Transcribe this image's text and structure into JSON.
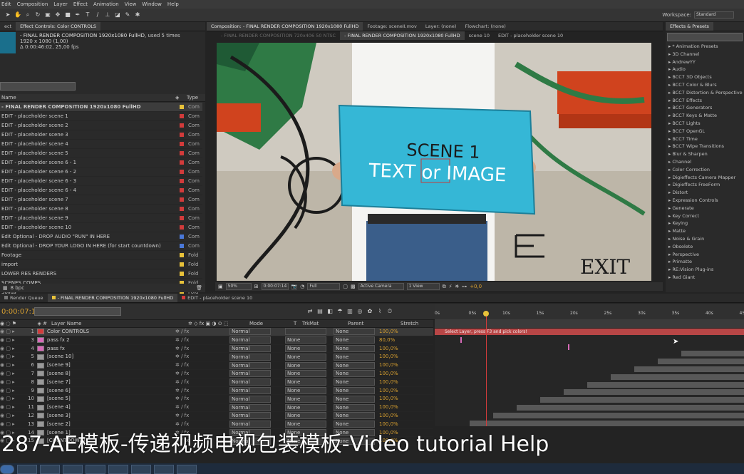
{
  "menu": {
    "items": [
      "Edit",
      "Composition",
      "Layer",
      "Effect",
      "Animation",
      "View",
      "Window",
      "Help"
    ]
  },
  "workspace": {
    "label": "Workspace:",
    "value": "Standard"
  },
  "panel_tabs": {
    "effect_controls": "Effect Controls: Color CONTROLS",
    "composition": "Composition: - FINAL RENDER COMPOSITION 1920x1080 FullHD",
    "footage": "Footage: sceneII.mov",
    "layer": "Layer: (none)",
    "flowchart": "Flowchart: (none)",
    "effects_presets": "Effects & Presets"
  },
  "project": {
    "comp_name": "- FINAL RENDER COMPOSITION 1920x1080 FullHD",
    "used_times": ", used 5 times",
    "dims": "1920 x 1080 (1,00)",
    "duration": "Δ 0:00:46:02, 25,00 fps",
    "col_name": "Name",
    "col_type": "Type",
    "bpc": "8 bpc",
    "items": [
      {
        "name": "- FINAL RENDER COMPOSITION 1920x1080 FullHD",
        "color": "#e8c23a",
        "type": "Com",
        "bold": true
      },
      {
        "name": "EDIT - placeholder  scene 1",
        "color": "#d23b3b",
        "type": "Com"
      },
      {
        "name": "EDIT - placeholder  scene 2",
        "color": "#d23b3b",
        "type": "Com"
      },
      {
        "name": "EDIT - placeholder  scene 3",
        "color": "#d23b3b",
        "type": "Com"
      },
      {
        "name": "EDIT - placeholder  scene 4",
        "color": "#d23b3b",
        "type": "Com"
      },
      {
        "name": "EDIT - placeholder  scene 5",
        "color": "#d23b3b",
        "type": "Com"
      },
      {
        "name": "EDIT - placeholder  scene 6 - 1",
        "color": "#d23b3b",
        "type": "Com"
      },
      {
        "name": "EDIT - placeholder  scene 6 - 2",
        "color": "#d23b3b",
        "type": "Com"
      },
      {
        "name": "EDIT - placeholder  scene 6 - 3",
        "color": "#d23b3b",
        "type": "Com"
      },
      {
        "name": "EDIT - placeholder  scene 6 - 4",
        "color": "#d23b3b",
        "type": "Com"
      },
      {
        "name": "EDIT - placeholder scene 7",
        "color": "#d23b3b",
        "type": "Com"
      },
      {
        "name": "EDIT - placeholder scene 8",
        "color": "#d23b3b",
        "type": "Com"
      },
      {
        "name": "EDIT - placeholder scene 9",
        "color": "#d23b3b",
        "type": "Com"
      },
      {
        "name": "EDIT - placeholder scene 10",
        "color": "#d23b3b",
        "type": "Com"
      },
      {
        "name": "Edit Optional - DROP AUDIO \"RUN\" IN HERE",
        "color": "#4a78d8",
        "type": "Com"
      },
      {
        "name": "Edit Optional - DROP YOUR LOGO IN HERE (for start countdown)",
        "color": "#4a78d8",
        "type": "Com"
      },
      {
        "name": "Footage",
        "color": "#e8c23a",
        "type": "Fold"
      },
      {
        "name": "import",
        "color": "#e8c23a",
        "type": "Fold"
      },
      {
        "name": "LOWER RES RENDERS",
        "color": "#e8c23a",
        "type": "Fold"
      },
      {
        "name": "SCENES COMPS",
        "color": "#e8c23a",
        "type": "Fold"
      },
      {
        "name": "Solids",
        "color": "#e8c23a",
        "type": "Fold"
      }
    ]
  },
  "comp_tabs": [
    "- FINAL RENDER COMPOSITION 720x406 50 NTSC",
    "- FINAL RENDER COMPOSITION 1920x1080 FullHD",
    "scene 10",
    "EDIT - placeholder scene 10"
  ],
  "viewer": {
    "sign_line1": "SCENE 1",
    "sign_line2": "TEXT or IMAGE",
    "graffiti": "EXIT",
    "zoom": "50%",
    "timecode": "0:00:07:14",
    "resolution": "Full",
    "camera": "Active Camera",
    "views": "1 View",
    "exposure": "+0,0"
  },
  "effects": [
    "* Animation Presets",
    "3D Channel",
    "AndrewYY",
    "Audio",
    "BCC7 3D Objects",
    "BCC7 Color & Blurs",
    "BCC7 Distortion & Perspective",
    "BCC7 Effects",
    "BCC7 Generators",
    "BCC7 Keys & Matte",
    "BCC7 Lights",
    "BCC7 OpenGL",
    "BCC7 Time",
    "BCC7 Wipe Transitions",
    "Blur & Sharpen",
    "Channel",
    "Color Correction",
    "Digieffects Camera Mapper",
    "Digieffects FreeForm",
    "Distort",
    "Expression Controls",
    "Generate",
    "Key Correct",
    "Keying",
    "Matte",
    "Noise & Grain",
    "Obsolete",
    "Perspective",
    "Primatte",
    "RE:Vision Plug-ins",
    "Red Giant"
  ],
  "timeline": {
    "tabs": [
      "Render Queue",
      "- FINAL RENDER COMPOSITION 1920x1080 FullHD",
      "EDIT - placeholder scene 10"
    ],
    "timecode": "0:00:07:14",
    "cols": {
      "layer_name": "Layer Name",
      "mode": "Mode",
      "t": "T",
      "trkmat": "TrkMat",
      "parent": "Parent",
      "stretch": "Stretch"
    },
    "ruler": [
      "0s",
      "05s",
      "10s",
      "15s",
      "20s",
      "25s",
      "30s",
      "35s",
      "40s",
      "45s"
    ],
    "tooltip": "Select Layer, press F3 and pick colors!",
    "layers": [
      {
        "num": "1",
        "name": "Color CONTROLS",
        "color": "#d23b3b",
        "mode": "Normal",
        "trkmat": "",
        "parent": "None",
        "stretch": "100,0%"
      },
      {
        "num": "3",
        "name": "pass fx 2",
        "color": "#d86ab8",
        "mode": "Normal",
        "trkmat": "None",
        "parent": "None",
        "stretch": "80,0%"
      },
      {
        "num": "4",
        "name": "pass fx",
        "color": "#d86ab8",
        "mode": "Normal",
        "trkmat": "None",
        "parent": "None",
        "stretch": "100,0%"
      },
      {
        "num": "5",
        "name": "[scene 10]",
        "color": "#9a9a9a",
        "mode": "Normal",
        "trkmat": "None",
        "parent": "None",
        "stretch": "100,0%"
      },
      {
        "num": "6",
        "name": "[scene 9]",
        "color": "#9a9a9a",
        "mode": "Normal",
        "trkmat": "None",
        "parent": "None",
        "stretch": "100,0%"
      },
      {
        "num": "7",
        "name": "[scene 8]",
        "color": "#9a9a9a",
        "mode": "Normal",
        "trkmat": "None",
        "parent": "None",
        "stretch": "100,0%"
      },
      {
        "num": "8",
        "name": "[scene 7]",
        "color": "#9a9a9a",
        "mode": "Normal",
        "trkmat": "None",
        "parent": "None",
        "stretch": "100,0%"
      },
      {
        "num": "9",
        "name": "[scene 6]",
        "color": "#9a9a9a",
        "mode": "Normal",
        "trkmat": "None",
        "parent": "None",
        "stretch": "100,0%"
      },
      {
        "num": "10",
        "name": "[scene 5]",
        "color": "#9a9a9a",
        "mode": "Normal",
        "trkmat": "None",
        "parent": "None",
        "stretch": "100,0%"
      },
      {
        "num": "11",
        "name": "[scene 4]",
        "color": "#9a9a9a",
        "mode": "Normal",
        "trkmat": "None",
        "parent": "None",
        "stretch": "100,0%"
      },
      {
        "num": "12",
        "name": "[scene 3]",
        "color": "#9a9a9a",
        "mode": "Normal",
        "trkmat": "None",
        "parent": "None",
        "stretch": "100,0%"
      },
      {
        "num": "13",
        "name": "[scene 2]",
        "color": "#9a9a9a",
        "mode": "Normal",
        "trkmat": "None",
        "parent": "None",
        "stretch": "100,0%"
      },
      {
        "num": "14",
        "name": "[scene 1]",
        "color": "#9a9a9a",
        "mode": "Normal",
        "trkmat": "None",
        "parent": "None",
        "stretch": "100,0%"
      },
      {
        "num": "15",
        "name": "[COUNTDOWN]",
        "color": "#9a9a9a",
        "mode": "Normal",
        "trkmat": "None",
        "parent": "None",
        "stretch": "100,0%"
      }
    ]
  },
  "caption": "287-AE模板-传递视频电视包装模板-Video tutorial Help"
}
